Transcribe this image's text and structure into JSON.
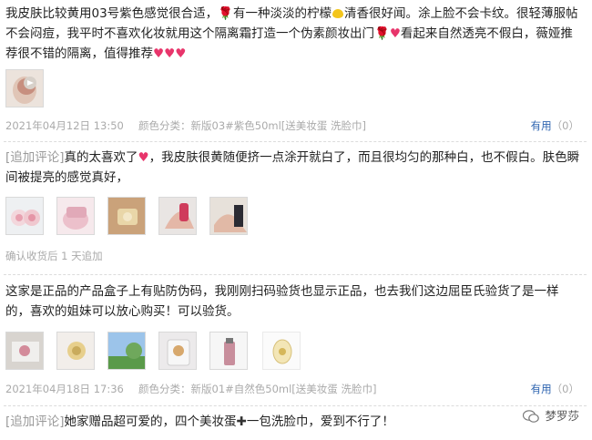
{
  "reviews": [
    {
      "text_parts": [
        "我皮肤比较黄用03号紫色感觉很合适，",
        "有一种淡淡的柠檬",
        "清香很好闻。涂上脸不会卡纹。很轻薄服帖不会闷痘，我平时不喜欢化妆就用这个隔离霜打造一个伪素颜妆出门",
        "看起来自然透亮不假白，薇娅推荐很不错的隔离，值得推荐"
      ],
      "date": "2021年04月12日 13:50",
      "variant": "颜色分类：新版03#紫色50ml[送美妆蛋 洗脸巾]",
      "useful_label": "有用",
      "useful_count": "（0）",
      "addon_tag": "[追加评论]",
      "addon_text_parts": [
        "真的太喜欢了",
        "，我皮肤很黄随便挤一点涂开就白了，而且很均匀的那种白，也不假白。肤色瞬间被提亮的感觉真好，"
      ],
      "addon_note": "确认收货后 1 天追加"
    },
    {
      "text": "这家是正品的产品盒子上有贴防伪码，我刚刚扫码验货也显示正品，也去我们这边屈臣氏验货了是一样的，喜欢的姐妹可以放心购买！可以验货。",
      "date": "2021年04月18日 17:36",
      "variant": "颜色分类：新版01#自然色50ml[送美妆蛋 洗脸巾]",
      "useful_label": "有用",
      "useful_count": "（0）",
      "addon_tag": "[追加评论]",
      "addon_text_parts": [
        "她家赠品超可爱的，四个美妆蛋",
        "一包洗脸巾，爱到不行了！"
      ]
    }
  ],
  "watermark": "梦罗莎",
  "colors": {
    "link": "#2e64b0",
    "meta": "#aaaaaa",
    "heart": "#e8356b"
  }
}
